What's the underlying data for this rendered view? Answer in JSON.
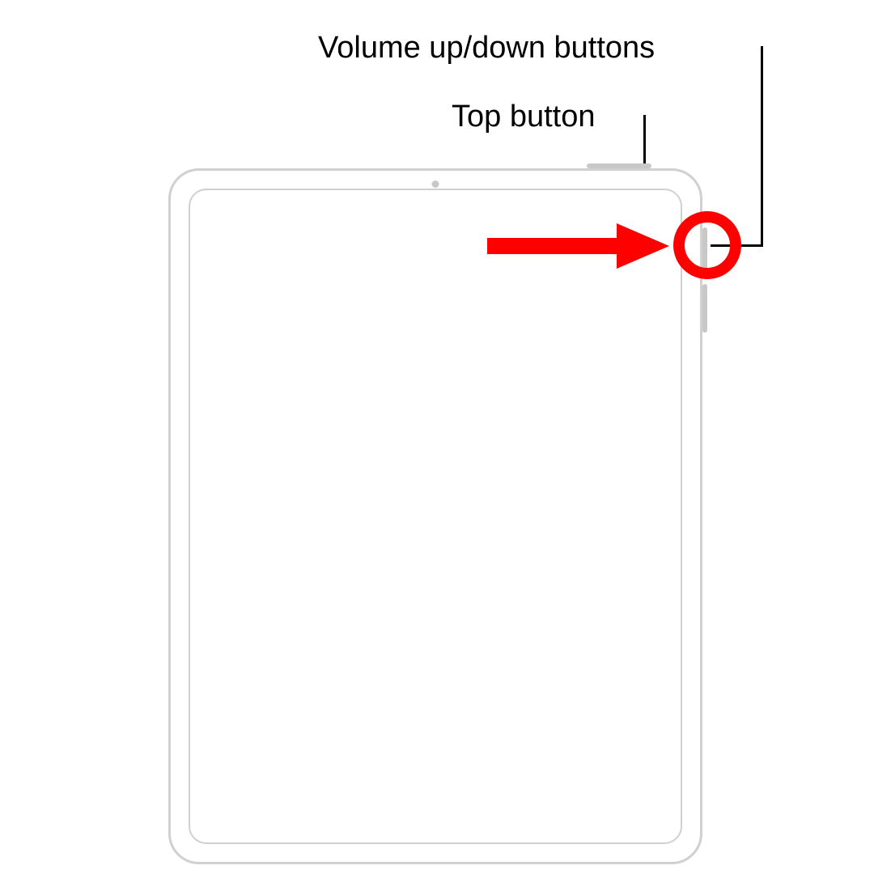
{
  "labels": {
    "topButton": "Top button",
    "volume": "Volume up/down buttons"
  },
  "annotations": {
    "arrowColor": "#ff0000",
    "circleColor": "#ff0000"
  }
}
